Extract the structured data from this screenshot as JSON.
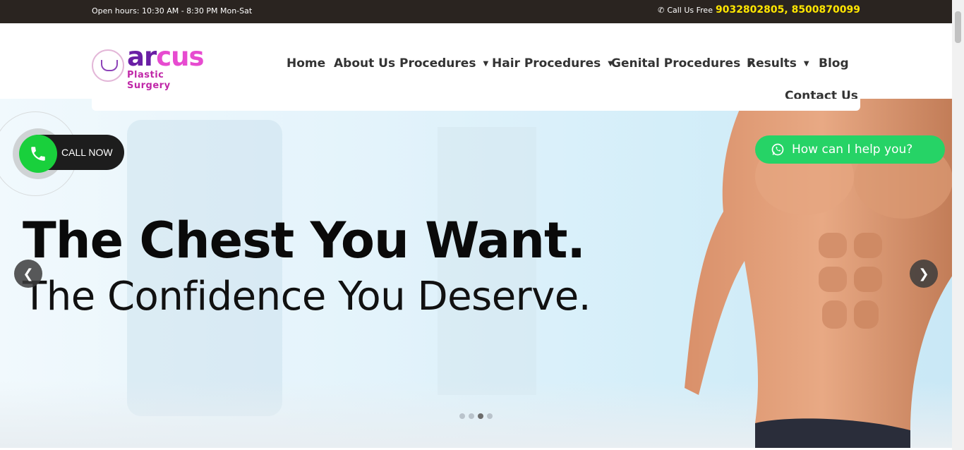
{
  "topbar": {
    "hours": "Open hours: 10:30 AM - 8:30 PM Mon-Sat",
    "call_label": "Call Us Free",
    "phones": "9032802805, 8500870099"
  },
  "logo": {
    "name_part1": "ar",
    "name_part2": "cus",
    "tagline": "Plastic Surgery"
  },
  "nav": {
    "items": [
      {
        "label": "Home"
      },
      {
        "label": "About Us"
      },
      {
        "label": "Procedures"
      },
      {
        "label": "Hair Procedures"
      },
      {
        "label": "Genital Procedures"
      },
      {
        "label": "Results"
      },
      {
        "label": "Blog"
      },
      {
        "label": "Contact Us"
      }
    ]
  },
  "hero": {
    "headline": "The Chest You Want.",
    "subline": "The Confidence You Deserve.",
    "slides_total": 4,
    "active_slide": 3
  },
  "callnow": {
    "label": "CALL NOW"
  },
  "whatsapp": {
    "label": "How can I help you?"
  },
  "colors": {
    "topbar_bg": "#2a2420",
    "phone_highlight": "#ffe600",
    "brand_purple": "#6a1fa5",
    "brand_pink": "#e74bd0",
    "whatsapp_green": "#26d366",
    "call_green": "#19d03c"
  },
  "icons": {
    "phone": "phone-icon",
    "whatsapp": "whatsapp-icon",
    "caret": "caret-down-icon",
    "prev": "chevron-left-icon",
    "next": "chevron-right-icon"
  }
}
